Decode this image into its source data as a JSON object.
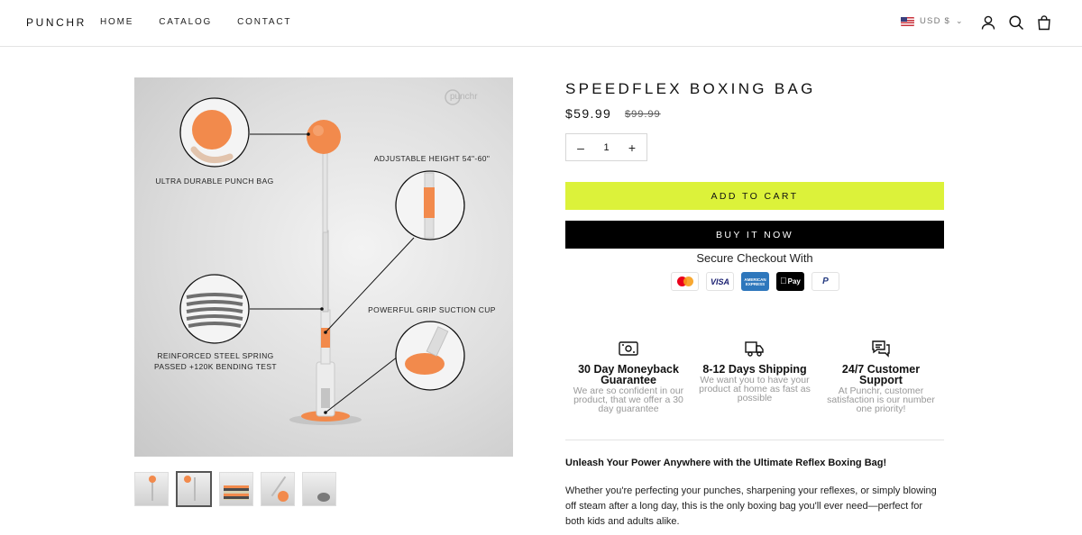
{
  "header": {
    "logo": "PUNCHR",
    "nav": [
      "HOME",
      "CATALOG",
      "CONTACT"
    ],
    "currency": "USD $",
    "icons": [
      "account-icon",
      "search-icon",
      "cart-icon"
    ]
  },
  "gallery": {
    "watermark": "punchr",
    "callouts": {
      "bag": "ULTRA DURABLE PUNCH BAG",
      "height": "ADJUSTABLE HEIGHT 54\"-60\"",
      "spring_1": "REINFORCED STEEL SPRING",
      "spring_2": "PASSED +120K BENDING TEST",
      "grip": "POWERFUL GRIP SUCTION CUP"
    },
    "thumbnail_count": 5,
    "active_thumbnail": 2,
    "accent": "#f28a4c"
  },
  "product": {
    "title": "SPEEDFLEX BOXING BAG",
    "price": "$59.99",
    "compare_price": "$99.99",
    "quantity": "1",
    "add_to_cart": "ADD TO CART",
    "buy_now": "BUY IT NOW",
    "secure_checkout": "Secure Checkout With",
    "payments": {
      "visa": "VISA",
      "amex": "AMERICAN EXPRESS",
      "apple": "Pay",
      "paypal": "P"
    }
  },
  "features": [
    {
      "icon": "money-icon",
      "title": "30 Day Moneyback Guarantee",
      "text": "We are so confident in our product, that we offer a 30 day guarantee"
    },
    {
      "icon": "truck-icon",
      "title": "8-12 Days Shipping",
      "text": "We want you to have your product at home as fast as possible"
    },
    {
      "icon": "chat-icon",
      "title": "24/7 Customer Support",
      "text": "At Punchr, customer satisfaction is our number one priority!"
    }
  ],
  "description": {
    "headline": "Unleash Your Power Anywhere with the Ultimate Reflex Boxing Bag!",
    "body": "Whether you're perfecting your punches, sharpening your reflexes, or simply blowing off steam after a long day, this is the only boxing bag you'll ever need—perfect for both kids and adults alike."
  },
  "colors": {
    "cart_button": "#dcf23a",
    "buy_button": "#000000",
    "accent_orange": "#f28a4c"
  }
}
